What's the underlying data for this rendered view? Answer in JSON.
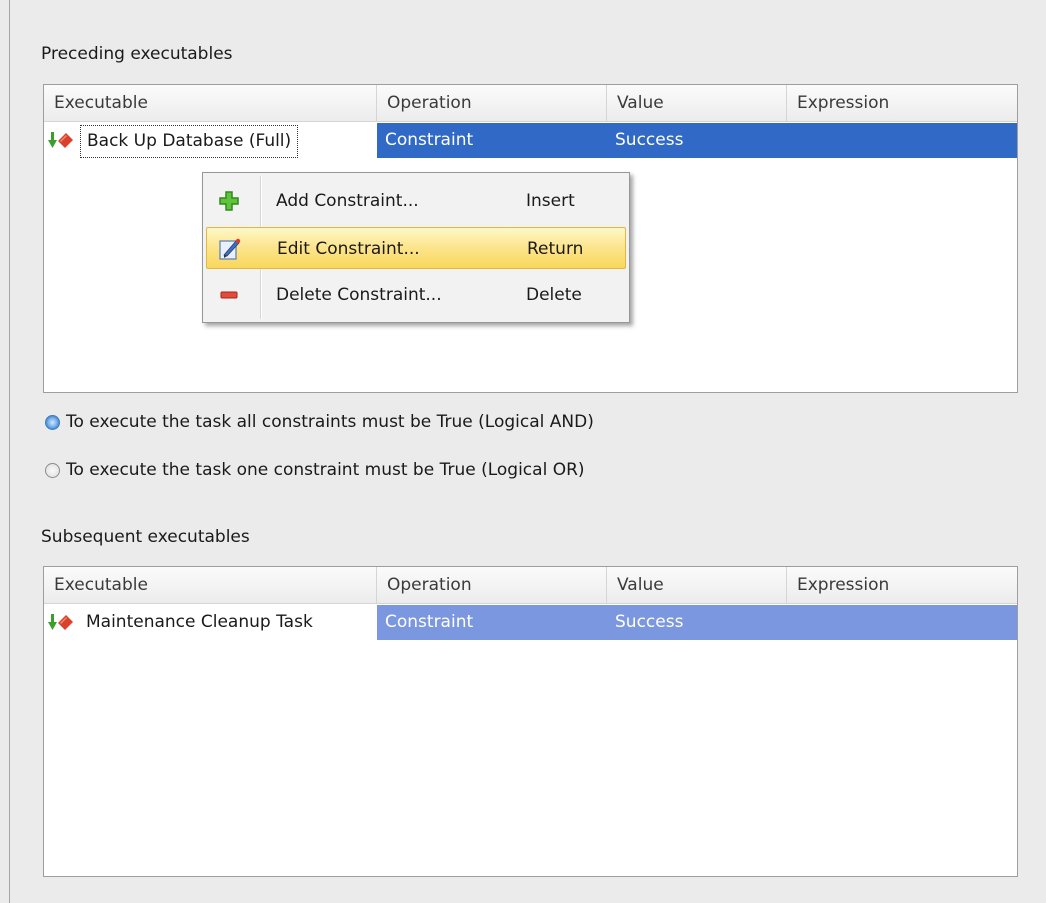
{
  "preceding": {
    "label": "Preceding executables",
    "columns": [
      "Executable",
      "Operation",
      "Value",
      "Expression"
    ],
    "rows": [
      {
        "executable": "Back Up Database (Full)",
        "operation": "Constraint",
        "value": "Success",
        "expression": ""
      }
    ]
  },
  "context_menu": {
    "items": [
      {
        "label": "Add Constraint...",
        "shortcut": "Insert",
        "icon": "plus-icon"
      },
      {
        "label": "Edit Constraint...",
        "shortcut": "Return",
        "icon": "edit-icon",
        "highlighted": true
      },
      {
        "label": "Delete Constraint...",
        "shortcut": "Delete",
        "icon": "minus-icon"
      }
    ]
  },
  "logic": {
    "options": [
      {
        "label": "To execute the task all constraints must be True (Logical AND)",
        "checked": true
      },
      {
        "label": "To execute the task one constraint must be True (Logical OR)",
        "checked": false
      }
    ]
  },
  "subsequent": {
    "label": "Subsequent executables",
    "columns": [
      "Executable",
      "Operation",
      "Value",
      "Expression"
    ],
    "rows": [
      {
        "executable": "Maintenance Cleanup Task",
        "operation": "Constraint",
        "value": "Success",
        "expression": ""
      }
    ]
  },
  "colors": {
    "selection_active": "#3169c6",
    "selection_inactive": "#7b97e0",
    "menu_highlight": "#fce48a"
  }
}
